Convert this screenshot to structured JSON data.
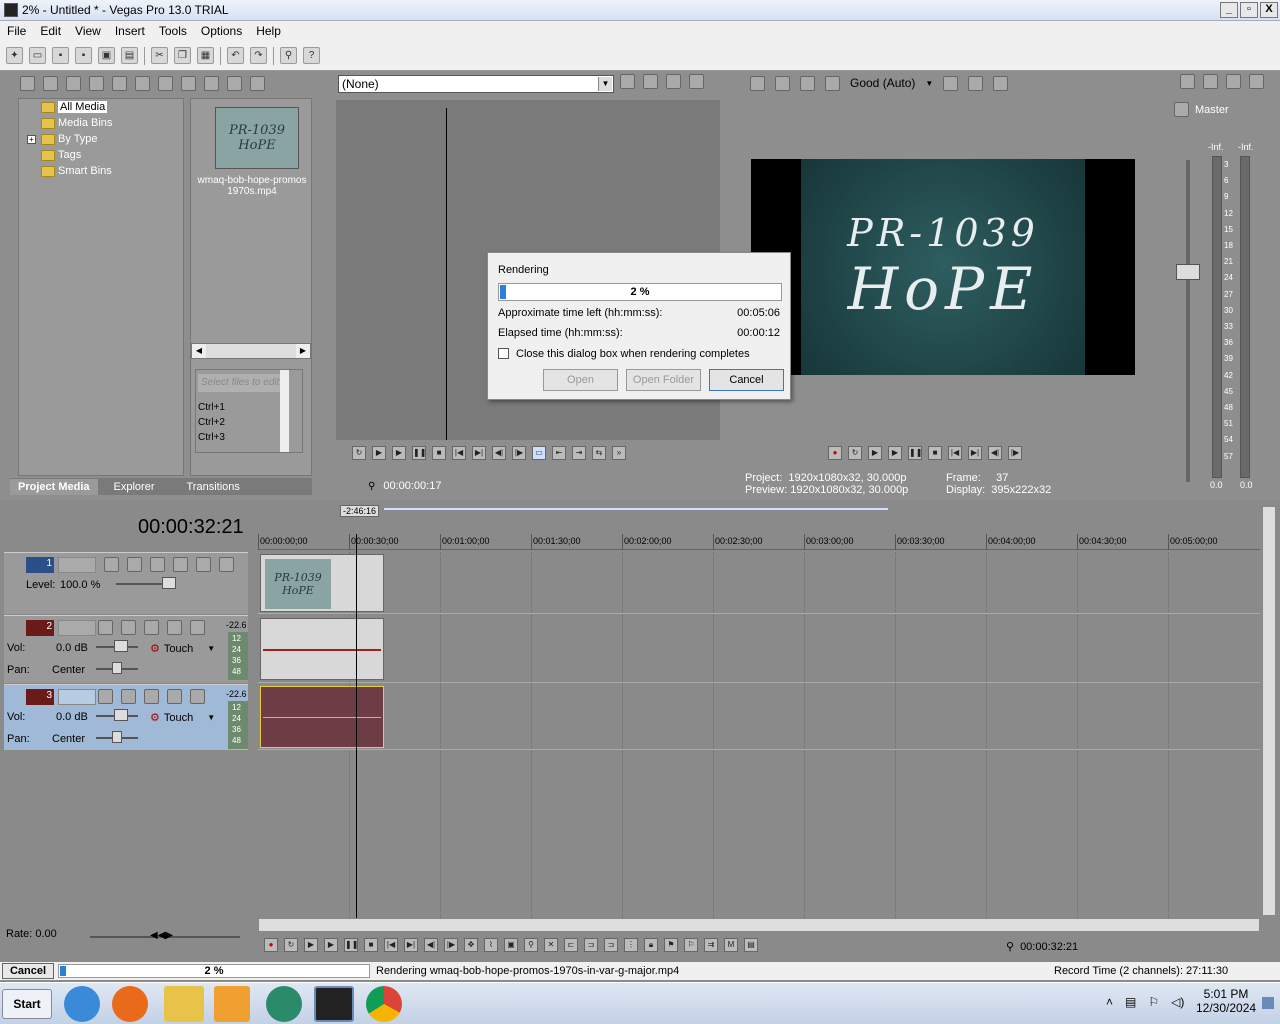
{
  "window": {
    "title": "2% - Untitled * - Vegas Pro 13.0 TRIAL",
    "min": "_",
    "max": "▫",
    "close": "X"
  },
  "menu": [
    "File",
    "Edit",
    "View",
    "Insert",
    "Tools",
    "Options",
    "Help"
  ],
  "explorer": {
    "tree": [
      "All Media",
      "Media Bins",
      "By Type",
      "Tags",
      "Smart Bins"
    ],
    "media_caption": "wmaq-bob-hope-promos 1970s.mp4",
    "thumb_line1": "PR-1039",
    "thumb_line2": "HoPE",
    "tags_placeholder": "Select files to edit tag",
    "shortcuts": [
      "Ctrl+1",
      "Ctrl+2",
      "Ctrl+3"
    ],
    "tabs": [
      "Project Media",
      "Explorer",
      "Transitions"
    ]
  },
  "trimmer": {
    "dropdown": "(None)",
    "time": "00:00:00:17"
  },
  "preview": {
    "quality": "Good (Auto)",
    "project_label": "Project:",
    "project_value": "1920x1080x32, 30.000p",
    "preview_label": "Preview:",
    "preview_value": "1920x1080x32, 30.000p",
    "frame_label": "Frame:",
    "frame_value": "37",
    "display_label": "Display:",
    "display_value": "395x222x32"
  },
  "master": {
    "label": "Master",
    "inf_left": "-Inf.",
    "inf_right": "-Inf.",
    "scale": [
      "3",
      "6",
      "9",
      "12",
      "15",
      "18",
      "21",
      "24",
      "27",
      "30",
      "33",
      "36",
      "39",
      "42",
      "45",
      "48",
      "51",
      "54",
      "57"
    ],
    "bottom_left": "0.0",
    "bottom_right": "0.0"
  },
  "dialog": {
    "title": "Rendering",
    "progress_text": "2 %",
    "progress_fraction": 0.02,
    "time_left_label": "Approximate time left (hh:mm:ss):",
    "time_left_value": "00:05:06",
    "elapsed_label": "Elapsed time (hh:mm:ss):",
    "elapsed_value": "00:00:12",
    "checkbox_label": "Close this dialog box when rendering completes",
    "open": "Open",
    "open_folder": "Open Folder",
    "cancel": "Cancel"
  },
  "timeline": {
    "current_time": "00:00:32:21",
    "region_length": "-2:46:16",
    "ruler": [
      "00:00:00;00",
      "00:00:30;00",
      "00:01:00;00",
      "00:01:30;00",
      "00:02:00;00",
      "00:02:30;00",
      "00:03:00;00",
      "00:03:30;00",
      "00:04:00;00",
      "00:04:30;00",
      "00:05:00;00"
    ],
    "tracks": [
      {
        "num": "1",
        "level_label": "Level:",
        "level_value": "100.0 %"
      },
      {
        "num": "2",
        "vol_label": "Vol:",
        "vol_value": "0.0 dB",
        "pan_label": "Pan:",
        "pan_value": "Center",
        "mode": "Touch",
        "meter_top": "-22.6",
        "meter_marks": [
          "12",
          "24",
          "36",
          "48"
        ]
      },
      {
        "num": "3",
        "vol_label": "Vol:",
        "vol_value": "0.0 dB",
        "pan_label": "Pan:",
        "pan_value": "Center",
        "mode": "Touch",
        "meter_top": "-22.6",
        "meter_marks": [
          "12",
          "24",
          "36",
          "48"
        ]
      }
    ],
    "rate": "Rate: 0.00",
    "bottom_time": "00:00:32:21"
  },
  "status": {
    "cancel": "Cancel",
    "progress_text": "2 %",
    "progress_fraction": 0.02,
    "message": "Rendering wmaq-bob-hope-promos-1970s-in-var-g-major.mp4",
    "record_time": "Record Time (2 channels): 27:11:30"
  },
  "taskbar": {
    "start": "Start",
    "time": "5:01 PM",
    "date": "12/30/2024"
  }
}
